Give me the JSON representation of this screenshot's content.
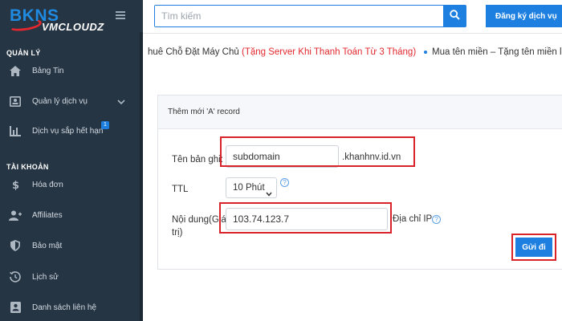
{
  "brand": {
    "logo_main": "BKNS",
    "logo_sub": "VMCLOUDZ"
  },
  "sidebar": {
    "sections": [
      {
        "title": "QUẢN LÝ"
      },
      {
        "title": "TÀI KHOẢN"
      }
    ],
    "items": [
      {
        "label": "Bảng Tin",
        "icon": "home-icon"
      },
      {
        "label": "Quản lý dịch vụ",
        "icon": "id-card-icon",
        "has_submenu": true
      },
      {
        "label": "Dịch vụ sắp hết hạn",
        "icon": "bar-chart-icon",
        "badge": "1"
      },
      {
        "label": "Hóa đơn",
        "icon": "dollar-icon"
      },
      {
        "label": "Affiliates",
        "icon": "user-plus-icon"
      },
      {
        "label": "Bảo mật",
        "icon": "shield-icon"
      },
      {
        "label": "Lịch sử",
        "icon": "history-icon"
      },
      {
        "label": "Danh sách liên hệ",
        "icon": "contact-card-icon"
      }
    ]
  },
  "header": {
    "search_placeholder": "Tìm kiếm",
    "register_label": "Đăng ký dịch vụ"
  },
  "marquee": {
    "text1_prefix": "huê Chỗ Đặt Máy Chủ ",
    "text1_highlight": "(Tặng Server Khi Thanh Toán Từ 3 Tháng)",
    "text2": "Mua tên miền – Tặng tên miền liên"
  },
  "form": {
    "card_title": "Thêm mới 'A' record",
    "record_name_label": "Tên bản ghi:",
    "record_name_value": "subdomain",
    "domain_suffix": ".khanhnv.id.vn",
    "ttl_label": "TTL",
    "ttl_value": "10 Phút",
    "content_label_line1": "Nội dung(Giá",
    "content_label_line2": "trị)",
    "content_value": "103.74.123.7",
    "ip_hint": "Địa chỉ IP",
    "help_glyph": "?",
    "submit_label": "Gửi đi"
  },
  "colors": {
    "sidebar_bg": "#263544",
    "accent": "#1d7fe0",
    "highlight_red": "#d8232a"
  }
}
